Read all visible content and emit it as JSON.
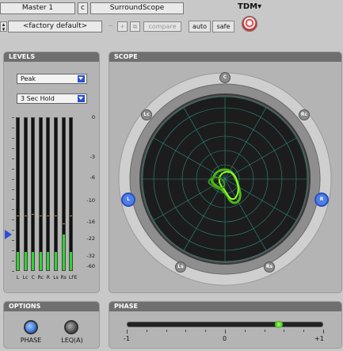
{
  "header": {
    "track": "Master 1",
    "channel_letter": "c",
    "plugin_name": "SurroundScope",
    "preset": "<factory default>",
    "minus": "−",
    "plus": "+",
    "compare": "compare",
    "auto": "auto",
    "safe": "safe",
    "platform": "TDM",
    "platform_arrow": "▾"
  },
  "levels": {
    "title": "LEVELS",
    "mode": "Peak",
    "hold": "3 Sec Hold",
    "scale": [
      "0",
      "-3",
      "-6",
      "-10",
      "-16",
      "-22",
      "-32",
      "-60"
    ],
    "channels": [
      {
        "label": "L",
        "level": 0.12,
        "hold": 0.35
      },
      {
        "label": "Lc",
        "level": 0.12,
        "hold": 0.35
      },
      {
        "label": "C",
        "level": 0.12,
        "hold": 0.36
      },
      {
        "label": "Rc",
        "level": 0.12,
        "hold": 0.35
      },
      {
        "label": "R",
        "level": 0.12,
        "hold": 0.35
      },
      {
        "label": "Ls",
        "level": 0.12,
        "hold": 0.35
      },
      {
        "label": "Rs",
        "level": 0.23,
        "hold": 0.3
      },
      {
        "label": "LFE",
        "level": 0.12,
        "hold": 0.35
      }
    ]
  },
  "scope": {
    "title": "SCOPE",
    "speakers": [
      "C",
      "Lc",
      "Rc",
      "L",
      "R",
      "Ls",
      "Rs"
    ]
  },
  "options": {
    "title": "OPTIONS",
    "phase_label": "PHASE",
    "leq_label": "LEQ(A)"
  },
  "phase": {
    "title": "PHASE",
    "min": "-1",
    "mid": "0",
    "max": "+1",
    "value": 0.55
  },
  "colors": {
    "trace": "#8bff2a",
    "meter": "#2fd52f",
    "accent": "#2a4fd0"
  }
}
